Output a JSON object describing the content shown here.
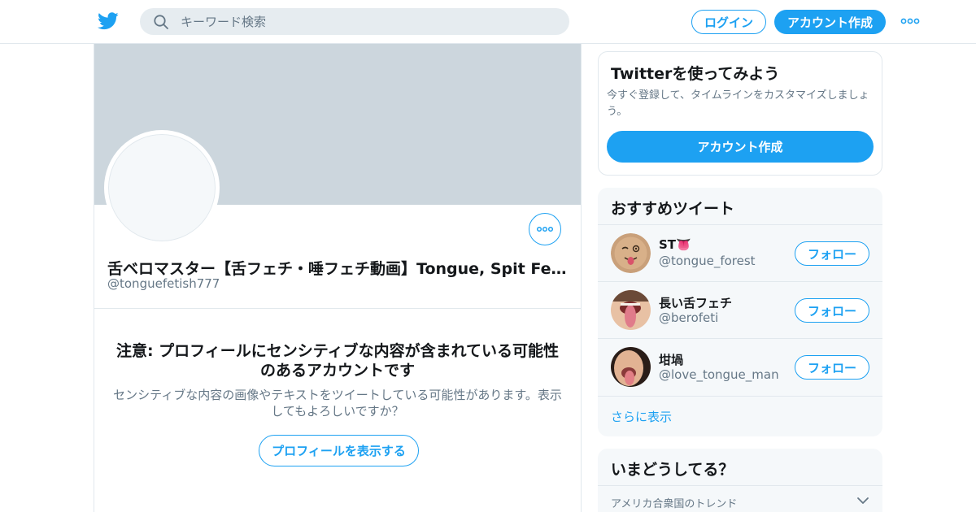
{
  "header": {
    "search_placeholder": "キーワード検索",
    "login_label": "ログイン",
    "signup_label": "アカウント作成"
  },
  "profile": {
    "name": "舌ベロマスター【舌フェチ・唾フェチ動画】Tongue, Spit Fetish…",
    "handle": "@tonguefetish777",
    "warning_title": "注意: プロフィールにセンシティブな内容が含まれている可能性のあるアカウントです",
    "warning_text": "センシティブな内容の画像やテキストをツイートしている可能性があります。表示してもよろしいですか？",
    "show_button": "プロフィールを表示する"
  },
  "signup_card": {
    "title": "Twitterを使ってみよう",
    "description": "今すぐ登録して、タイムラインをカスタマイズしましょう。",
    "button": "アカウント作成"
  },
  "recommended": {
    "title": "おすすめツイート",
    "follow_label": "フォロー",
    "more_label": "さらに表示",
    "accounts": [
      {
        "name": "ST👅",
        "handle": "@tongue_forest"
      },
      {
        "name": "長い舌フェチ",
        "handle": "@berofeti"
      },
      {
        "name": "坩堝",
        "handle": "@love_tongue_man"
      }
    ]
  },
  "trends": {
    "title": "いまどうしてる？",
    "subtitle": "アメリカ合衆国のトレンド"
  },
  "colors": {
    "accent": "#1da1f2",
    "banner": "#ccd6dd",
    "muted_text": "#657786",
    "card_bg": "#f5f8fa",
    "border": "#e1e8ed"
  },
  "icons": [
    "twitter-logo-icon",
    "search-icon",
    "more-dots-icon",
    "chevron-down-icon"
  ]
}
